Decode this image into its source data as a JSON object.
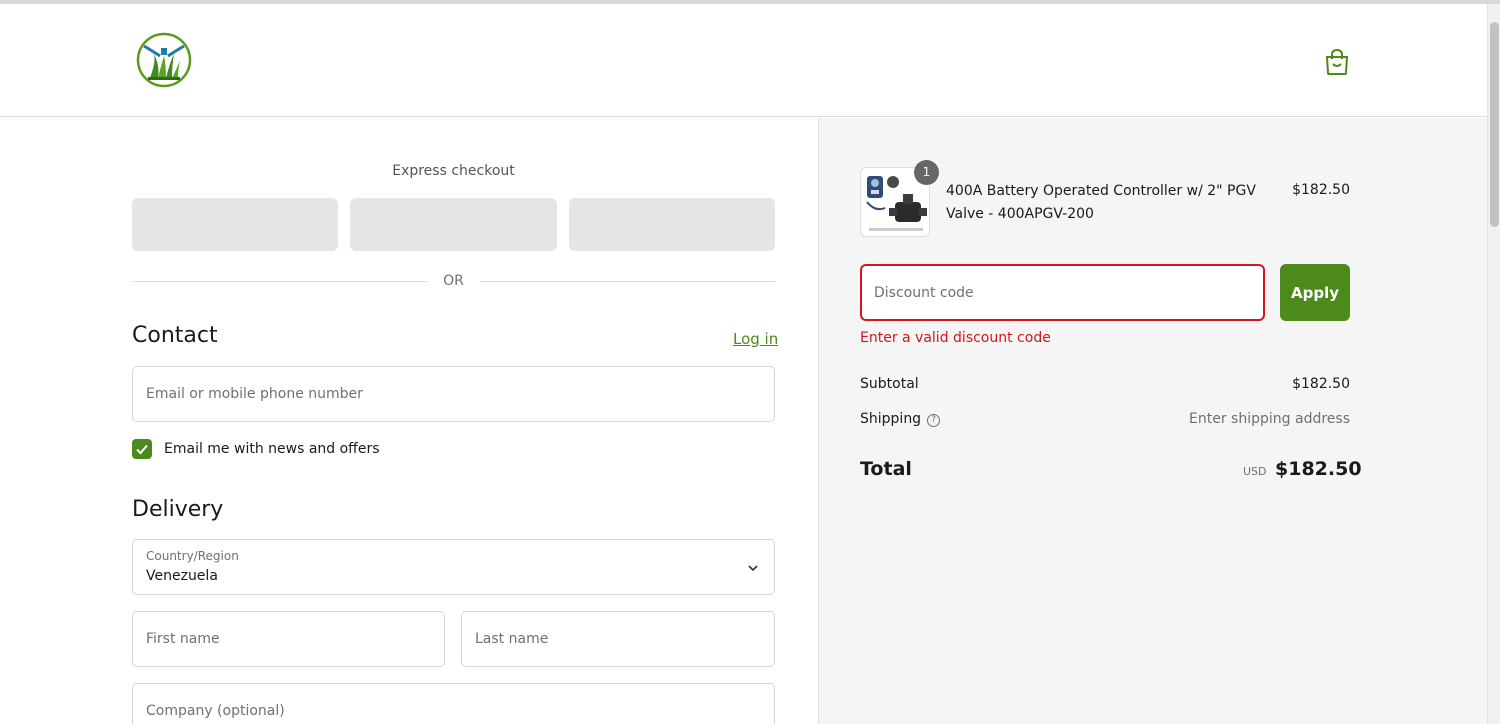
{
  "colors": {
    "accent": "#4b8a1b",
    "error": "#d4151c",
    "sidebar_bg": "#f5f5f5"
  },
  "header": {
    "logo_icon": "lawn-sprinkler-logo",
    "cart_icon": "shopping-bag-icon"
  },
  "express": {
    "title": "Express checkout",
    "or_label": "OR"
  },
  "contact": {
    "title": "Contact",
    "login_label": "Log in",
    "email_placeholder": "Email or mobile phone number",
    "newsletter_label": "Email me with news and offers",
    "newsletter_checked": true
  },
  "delivery": {
    "title": "Delivery",
    "country_label": "Country/Region",
    "country_value": "Venezuela",
    "first_name_placeholder": "First name",
    "last_name_placeholder": "Last name",
    "company_placeholder": "Company (optional)"
  },
  "order": {
    "item": {
      "name": "400A Battery Operated Controller w/ 2\" PGV Valve - 400APGV-200",
      "price": "$182.50",
      "quantity": "1"
    },
    "discount_placeholder": "Discount code",
    "apply_label": "Apply",
    "discount_error": "Enter a valid discount code",
    "subtotal_label": "Subtotal",
    "subtotal_value": "$182.50",
    "shipping_label": "Shipping",
    "shipping_value": "Enter shipping address",
    "total_label": "Total",
    "total_currency": "USD",
    "total_value": "$182.50"
  }
}
